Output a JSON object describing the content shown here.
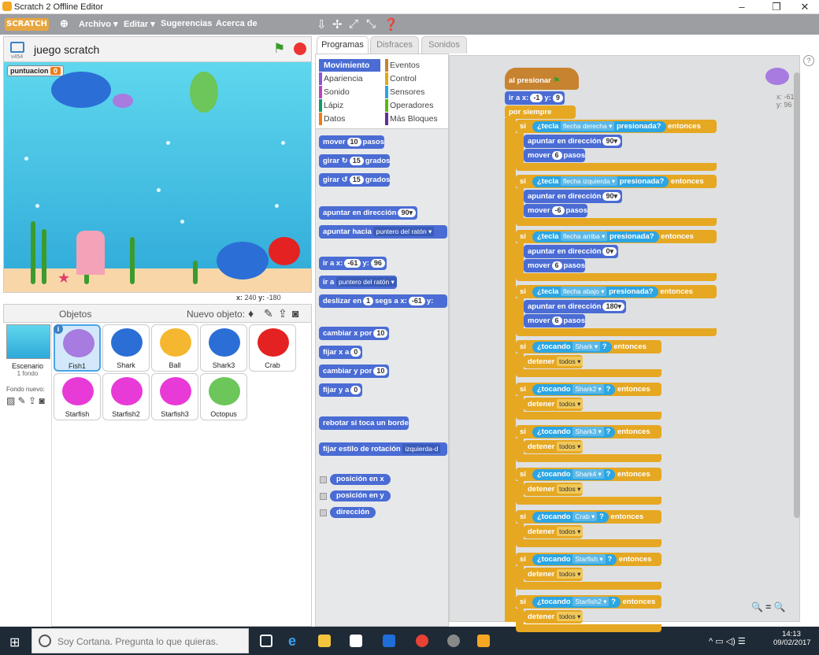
{
  "window": {
    "title": "Scratch 2 Offline Editor"
  },
  "menubar": {
    "logo": "SCRATCH",
    "items": [
      "Archivo ▾",
      "Editar ▾",
      "Sugerencias",
      "Acerca de"
    ]
  },
  "stage": {
    "project_title": "juego scratch",
    "version_label": "v454",
    "variable_name": "puntuacion",
    "variable_value": "0",
    "coord_x_label": "x:",
    "coord_x": "240",
    "coord_y_label": "y:",
    "coord_y": "-180"
  },
  "sprites_panel": {
    "title": "Objetos",
    "new_sprite_label": "Nuevo objeto:",
    "scene_label": "Escenario",
    "scene_sub": "1 fondo",
    "new_bg_label": "Fondo nuevo:",
    "sprites": [
      "Fish1",
      "Shark",
      "Ball",
      "Shark3",
      "Crab",
      "Starfish",
      "Starfish2",
      "Starfish3",
      "Octopus"
    ]
  },
  "tabs": [
    "Programas",
    "Disfraces",
    "Sonidos"
  ],
  "categories": [
    {
      "name": "Movimiento",
      "color": "#4a6cd4"
    },
    {
      "name": "Eventos",
      "color": "#c88330"
    },
    {
      "name": "Apariencia",
      "color": "#8a55d7"
    },
    {
      "name": "Control",
      "color": "#e1a91a"
    },
    {
      "name": "Sonido",
      "color": "#bb42c3"
    },
    {
      "name": "Sensores",
      "color": "#2ca5e2"
    },
    {
      "name": "Lápiz",
      "color": "#0e9a6c"
    },
    {
      "name": "Operadores",
      "color": "#5cb712"
    },
    {
      "name": "Datos",
      "color": "#ee7d16"
    },
    {
      "name": "Más Bloques",
      "color": "#632d99"
    }
  ],
  "palette": {
    "mover": "mover",
    "mover_n": "10",
    "pasos": "pasos",
    "girar": "girar",
    "girar_n": "15",
    "grados": "grados",
    "apuntar_dir": "apuntar en dirección",
    "apuntar_dir_n": "90▾",
    "apuntar_hacia": "apuntar hacia",
    "apuntar_hacia_dd": "puntero del ratón ▾",
    "ir_a_xy": "ir a x:",
    "ir_x": "-61",
    "ir_y_label": "y:",
    "ir_y": "96",
    "ir_a": "ir a",
    "ir_a_dd": "puntero del ratón ▾",
    "deslizar": "deslizar en",
    "deslizar_n": "1",
    "deslizar_rest": "segs a x:",
    "deslizar_x": "-61",
    "deslizar_y": "y:",
    "cambiar_x": "cambiar x por",
    "cambiar_x_n": "10",
    "fijar_x": "fijar x a",
    "fijar_x_n": "0",
    "cambiar_y": "cambiar y por",
    "cambiar_y_n": "10",
    "fijar_y": "fijar y a",
    "fijar_y_n": "0",
    "rebotar": "rebotar si toca un borde",
    "estilo": "fijar estilo de rotación",
    "estilo_dd": "izquierda-d",
    "rep_x": "posición en x",
    "rep_y": "posición en y",
    "rep_dir": "dirección"
  },
  "script": {
    "hat": "al presionar",
    "goto": "ir a x:",
    "goto_x": "-1",
    "goto_y_label": "y:",
    "goto_y": "9",
    "forever": "por siempre",
    "si": "si",
    "entonces": "entonces",
    "tecla": "¿tecla",
    "presionada": "presionada?",
    "apuntar": "apuntar en dirección",
    "mover": "mover",
    "pasos": "pasos",
    "ifs_key": [
      {
        "key": "flecha derecha ▾",
        "dir": "90▾",
        "steps": "6"
      },
      {
        "key": "flecha izquierda ▾",
        "dir": "90▾",
        "steps": "-6"
      },
      {
        "key": "flecha arriba ▾",
        "dir": "0▾",
        "steps": "6"
      },
      {
        "key": "flecha abajo ▾",
        "dir": "180▾",
        "steps": "6"
      }
    ],
    "tocando": "¿tocando",
    "q": "?",
    "detener": "detener",
    "todos": "todos ▾",
    "ifs_touch": [
      "Shark ▾",
      "Shark2 ▾",
      "Shark3 ▾",
      "Shark4 ▾",
      "Crab ▾",
      "Starfish ▾",
      "Starfish2 ▾"
    ],
    "sprite_x": "x: -61",
    "sprite_y": "y: 96"
  },
  "taskbar": {
    "cortana": "Soy Cortana. Pregunta lo que quieras.",
    "time": "14:13",
    "date": "09/02/2017"
  }
}
